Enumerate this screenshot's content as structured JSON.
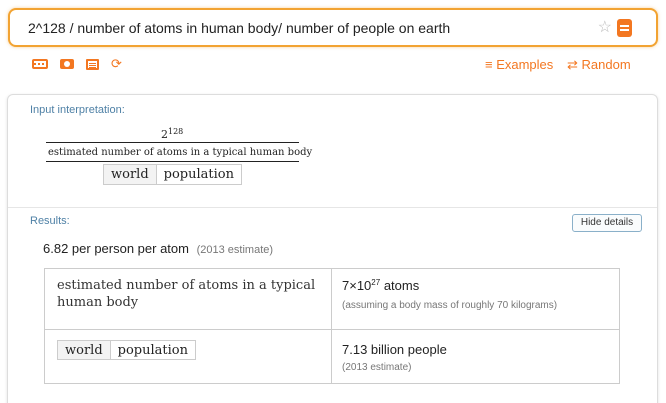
{
  "search": {
    "query": "2^128 / number of atoms in human body/ number of people on earth"
  },
  "toolbar": {
    "examples_label": "≡ Examples",
    "random_label": "⇄ Random",
    "icons": [
      "keyboard-icon",
      "camera-icon",
      "document-icon",
      "share-icon"
    ]
  },
  "input_pod": {
    "title": "Input interpretation:",
    "numerator_base": "2",
    "numerator_exp": "128",
    "denominator": "estimated number of atoms in a typical human body",
    "tag_first": "world",
    "tag_second": "population"
  },
  "results_pod": {
    "title": "Results:",
    "hide_details_label": "Hide details",
    "value": "6.82 per person per atom",
    "value_note": "(2013 estimate)"
  },
  "details_table": {
    "row1": {
      "label": "estimated number of atoms in a typical human body",
      "value_base": "7",
      "value_times": "×",
      "value_ten": "10",
      "value_exp": "27",
      "value_unit": " atoms",
      "note": "(assuming a body mass of roughly 70 kilograms)"
    },
    "row2": {
      "tag_first": "world",
      "tag_second": "population",
      "value": "7.13 billion people",
      "note": "(2013 estimate)"
    }
  },
  "colors": {
    "accent": "#f37721",
    "search_border": "#f2a332",
    "pod_title": "#4f81a6"
  }
}
